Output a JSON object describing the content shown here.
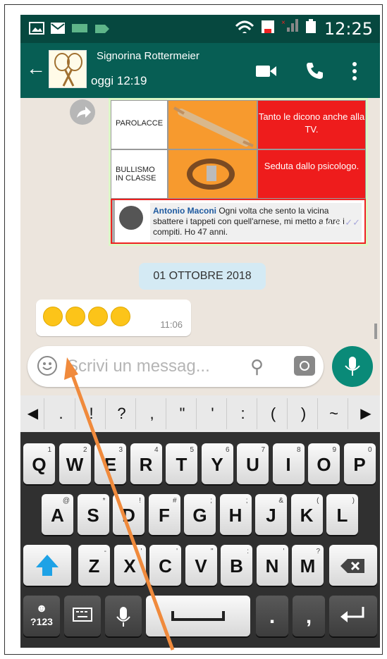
{
  "status_bar": {
    "time": "12:25"
  },
  "header": {
    "contact_name": "Signorina Rottermeier",
    "last_seen": "oggi 12:19"
  },
  "table_message": {
    "rows": [
      {
        "label": "PAROLACCE",
        "consequence": "Tanto le dicono anche alla TV."
      },
      {
        "label": "BULLISMO IN CLASSE",
        "consequence": "Seduta dallo psicologo."
      }
    ],
    "quoted": {
      "author": "Antonio Maconi",
      "text": "Ogni volta che sento la vicina sbattere i tappeti con quell'arnese, mi metto a fare i compiti. Ho 47 anni.",
      "time": "09:29"
    }
  },
  "date_chip": "01 OTTOBRE 2018",
  "emoji_message": {
    "time": "11:06"
  },
  "input": {
    "placeholder": "Scrivi un messag..."
  },
  "keyboard": {
    "symbols": [
      ".",
      "!",
      "?",
      ",",
      "\"",
      "'",
      ":",
      "(",
      ")",
      "~"
    ],
    "row1": [
      {
        "k": "Q",
        "s": "1"
      },
      {
        "k": "W",
        "s": "2"
      },
      {
        "k": "E",
        "s": "3"
      },
      {
        "k": "R",
        "s": "4"
      },
      {
        "k": "T",
        "s": "5"
      },
      {
        "k": "Y",
        "s": "6"
      },
      {
        "k": "U",
        "s": "7"
      },
      {
        "k": "I",
        "s": "8"
      },
      {
        "k": "O",
        "s": "9"
      },
      {
        "k": "P",
        "s": "0"
      }
    ],
    "row2": [
      {
        "k": "A",
        "s": "@"
      },
      {
        "k": "S",
        "s": "*"
      },
      {
        "k": "D",
        "s": "!"
      },
      {
        "k": "F",
        "s": "#"
      },
      {
        "k": "G",
        "s": ";"
      },
      {
        "k": "H",
        "s": ";"
      },
      {
        "k": "J",
        "s": "&"
      },
      {
        "k": "K",
        "s": "("
      },
      {
        "k": "L",
        "s": ")"
      }
    ],
    "row3": [
      {
        "k": "Z",
        "s": "-"
      },
      {
        "k": "X",
        "s": "'"
      },
      {
        "k": "C",
        "s": "'"
      },
      {
        "k": "V",
        "s": "\""
      },
      {
        "k": "B",
        "s": ":"
      },
      {
        "k": "N",
        "s": "'"
      },
      {
        "k": "M",
        "s": "?"
      }
    ],
    "mode_key": "?123"
  },
  "colors": {
    "header": "#075e54",
    "statusbar": "#06483f",
    "accent": "#0a8a78",
    "arrow": "#f08a3c"
  }
}
